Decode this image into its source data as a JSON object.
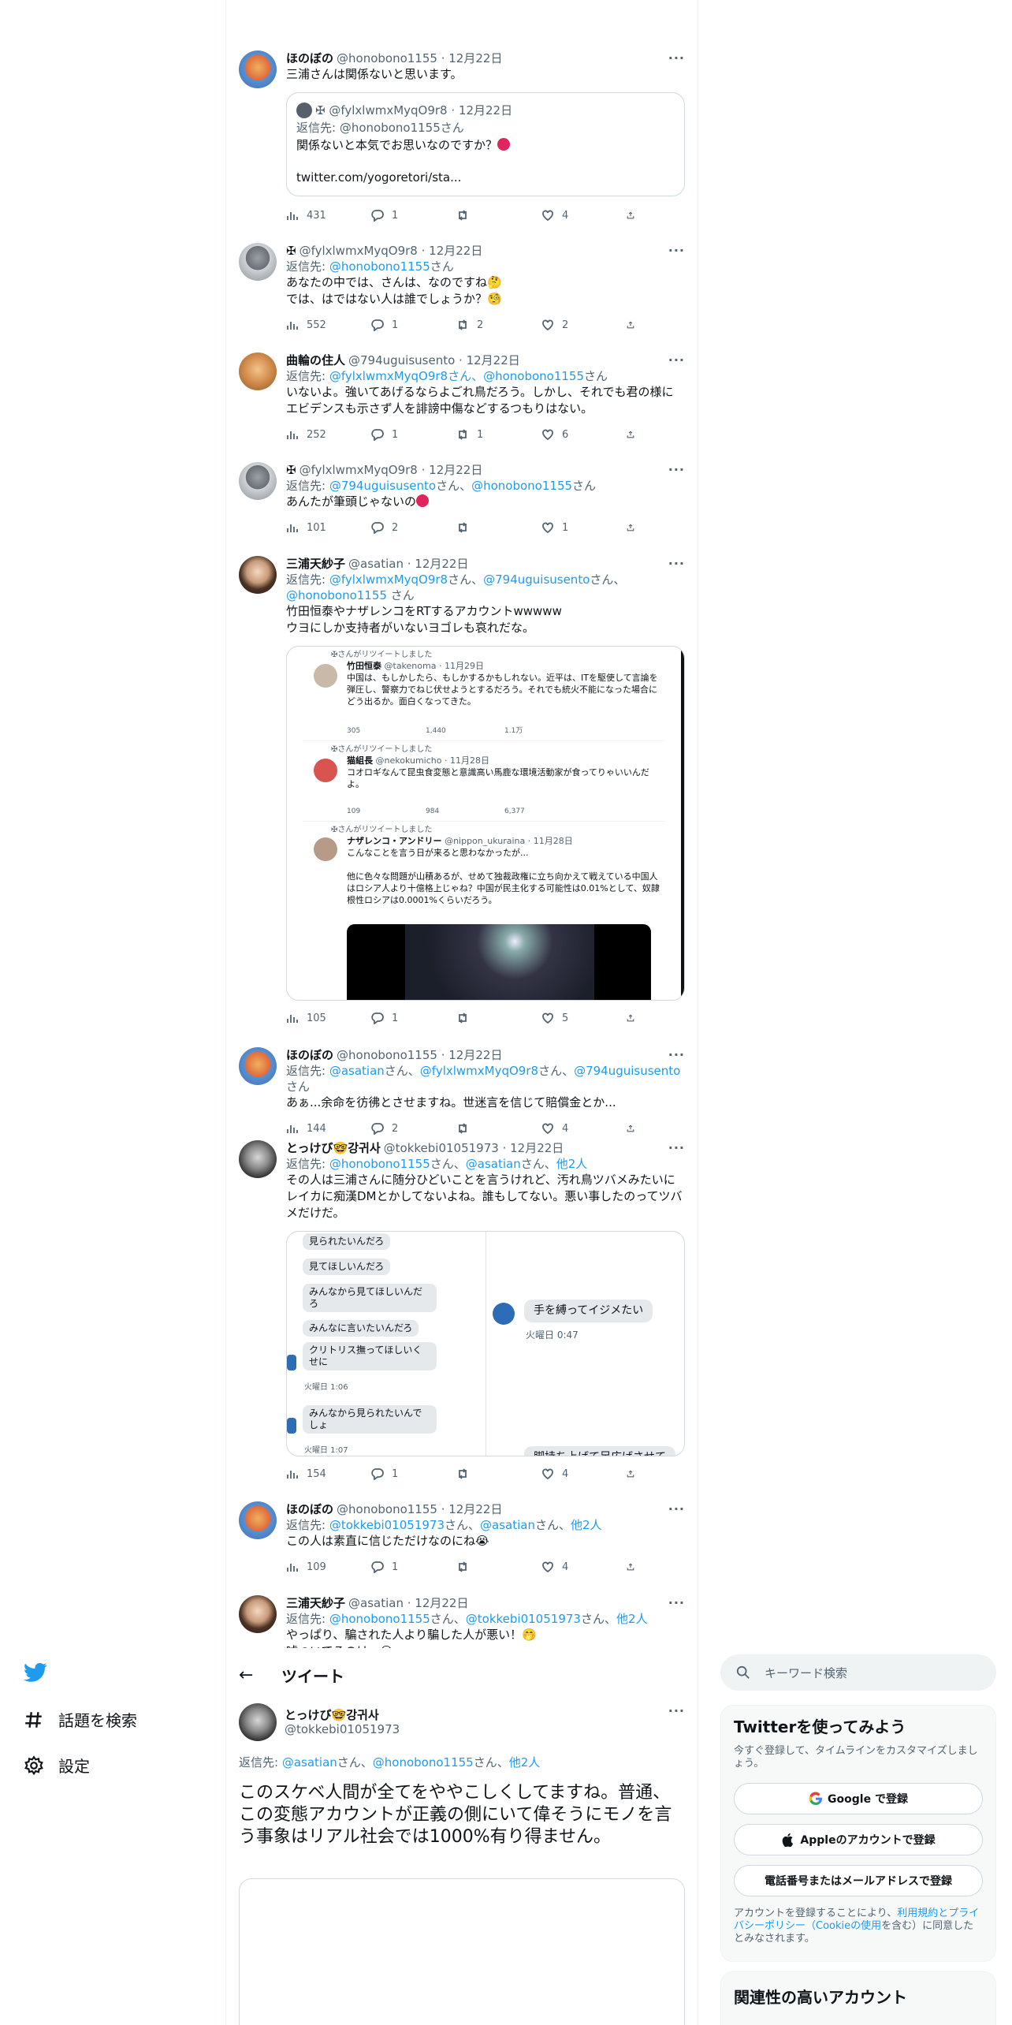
{
  "thread": [
    {
      "name": "ほのぼの",
      "handle": "@honobono1155",
      "date": "12月22日",
      "text": "三浦さんは関係ないと思います。",
      "quote": {
        "name": "✠ @fylxlwmxMyqO9r8",
        "date": "12月22日",
        "reply_prefix": "返信先: @honobono1155さん",
        "text": "関係ないと本気でお思いなのですか？",
        "link": "twitter.com/yogoretori/sta..."
      },
      "views": "431",
      "replies": "1",
      "retweets": "",
      "likes": "4"
    },
    {
      "name": "✠",
      "handle": "@fylxlwmxMyqO9r8",
      "date": "12月22日",
      "reply_label": "返信先: ",
      "reply_links": [
        "@honobono1155"
      ],
      "reply_suffix": "さん",
      "text": "あなたの中では、さんは、なのですね🤔\nでは、はではない人は誰でしょうか？🧐",
      "views": "552",
      "replies": "1",
      "retweets": "2",
      "likes": "2"
    },
    {
      "name": "曲輪の住人",
      "handle": "@794uguisusento",
      "date": "12月22日",
      "reply_label": "返信先: ",
      "reply_links": [
        "@fylxlwmxMyqO9r8さん、",
        "@honobono1155"
      ],
      "reply_suffix": "さん",
      "text": "いないよ。強いてあげるならよごれ鳥だろう。しかし、それでも君の様にエビデンスも示さず人を誹謗中傷などするつもりはない。",
      "views": "252",
      "replies": "1",
      "retweets": "1",
      "likes": "6"
    },
    {
      "name": "✠",
      "handle": "@fylxlwmxMyqO9r8",
      "date": "12月22日",
      "reply_label": "返信先: ",
      "reply_links": [
        "@794uguisusento",
        "さん、",
        "@honobono1155"
      ],
      "reply_suffix": "さん",
      "text": "あんたが筆頭じゃないの",
      "views": "101",
      "replies": "2",
      "retweets": "",
      "likes": "1"
    },
    {
      "name": "三浦天紗子",
      "handle": "@asatian",
      "date": "12月22日",
      "reply_label": "返信先: ",
      "reply_links": [
        "@fylxlwmxMyqO9r8",
        "@794uguisusento",
        "@honobono1155"
      ],
      "reply_suffix": "さん",
      "text": "竹田恒泰やナザレンコをRTするアカウントwwwww\nウヨにしか支持者がいないヨゴレも哀れだな。",
      "embedded": [
        {
          "rt": "✠さんがリツイートしました",
          "name": "竹田恒泰",
          "handle": "@takenoma",
          "date": "11月29日",
          "text": "中国は、もしかしたら、もしかするかもしれない。近平は、ITを駆使して言論を弾圧し、警察力でねじ伏せようとするだろう。それでも統火不能になった場合にどう出るか。面白くなってきた。",
          "replies": "305",
          "retweets": "1,440",
          "likes": "1.1万"
        },
        {
          "rt": "✠さんがリツイートしました",
          "name": "猫組長",
          "handle": "@nekokumicho",
          "date": "11月28日",
          "text": "コオロギなんて昆虫食変態と意識高い馬鹿な環境活動家が食ってりゃいいんだよ。",
          "replies": "109",
          "retweets": "984",
          "likes": "6,377"
        },
        {
          "rt": "✠さんがリツイートしました",
          "name": "ナザレンコ・アンドリー",
          "handle": "@nippon_ukuraina",
          "date": "11月28日",
          "text": "こんなことを言う日が来ると思わなかったが...\n\n他に色々な問題が山積あるが、せめて独裁政権に立ち向かえて戦えている中国人はロシア人より十億格上じゃね？中国が民主化する可能性は0.01%として、奴隷根性ロシアは0.0001%くらいだろう。"
        }
      ],
      "views": "105",
      "replies": "1",
      "retweets": "",
      "likes": "5"
    },
    {
      "name": "ほのぼの",
      "handle": "@honobono1155",
      "date": "12月22日",
      "reply_label": "返信先: ",
      "reply_links": [
        "@asatian",
        "@fylxlwmxMyqO9r8",
        "@794uguisusento"
      ],
      "reply_suffix": "さん",
      "text": "あぁ...余命を彷彿とさせますね。世迷言を信じて賠償金とか...",
      "views": "144",
      "replies": "2",
      "retweets": "",
      "likes": "4"
    },
    {
      "name": "とっけび🤓강귀사",
      "handle": "@tokkebi01051973",
      "date": "12月22日",
      "reply_label": "返信先: ",
      "reply_links": [
        "@honobono1155",
        "@asatian",
        "他2人"
      ],
      "reply_suffix": "",
      "text": "その人は三浦さんに随分ひどいことを言うけれど、汚れ鳥ツバメみたいにレイカに痴漢DMとかしてないよね。誰もしてない。悪い事したのってツバメだけだ。",
      "chat_left": [
        "見られたいんだろ",
        "見てほしいんだろ",
        "みんなから見てほしいんだろ",
        "みんなに言いたいんだろ",
        "クリトリス撫ってほしいくせに",
        "火曜日 1:06",
        "みんなから見られたいんでしょ",
        "火曜日 1:07"
      ],
      "chat_right": [
        "手を縛ってイジメたい",
        "火曜日 0:47",
        "脚持ち上げて足広げさせて"
      ],
      "views": "154",
      "replies": "1",
      "retweets": "",
      "likes": "4"
    },
    {
      "name": "ほのぼの",
      "handle": "@honobono1155",
      "date": "12月22日",
      "reply_label": "返信先: ",
      "reply_links": [
        "@tokkebi01051973",
        "@asatian",
        "他2人"
      ],
      "reply_suffix": "",
      "text": "この人は素直に信じただけなのにね😭",
      "views": "109",
      "replies": "1",
      "retweets": "",
      "likes": "4"
    },
    {
      "name": "三浦天紗子",
      "handle": "@asatian",
      "date": "12月22日",
      "reply_label": "返信先: ",
      "reply_links": [
        "@honobono1155",
        "@tokkebi01051973",
        "他2人"
      ],
      "reply_suffix": "",
      "text": "やっぱり、騙された人より騙した人が悪い！🤭\n嘘ついてるのは、😏"
    }
  ],
  "sidebar": {
    "explore_label": "話題を検索",
    "settings_label": "設定"
  },
  "main_bar": {
    "title": "ツイート"
  },
  "main_tweet": {
    "name": "とっけび🤓강귀사",
    "handle": "@tokkebi01051973",
    "reply_label": "返信先: ",
    "reply_links": [
      "@asatian",
      "@honobono1155",
      "他2人"
    ],
    "text": "このスケベ人間が全てをややこしくしてますね。普通、この変態アカウントが正義の側にいて偉そうにモノを言う事象はリアル社会では1000%有り得ません。"
  },
  "search": {
    "placeholder": "キーワード検索"
  },
  "signup": {
    "title": "Twitterを使ってみよう",
    "subtitle": "今すぐ登録して、タイムラインをカスタマイズしましょう。",
    "google": "Google で登録",
    "apple": "Appleのアカウントで登録",
    "phone": "電話番号またはメールアドレスで登録",
    "legal_1": "アカウントを登録することにより、",
    "legal_terms": "利用規約とプライバシーポリシー（Cookieの使用",
    "legal_2": "を含む）に同意したとみなされます。"
  },
  "related": {
    "title": "関連性の高いアカウント"
  },
  "colors": {
    "link": "#1d9bf0",
    "muted": "#536471",
    "text": "#0f1419",
    "twitter": "#1d9bf0"
  }
}
